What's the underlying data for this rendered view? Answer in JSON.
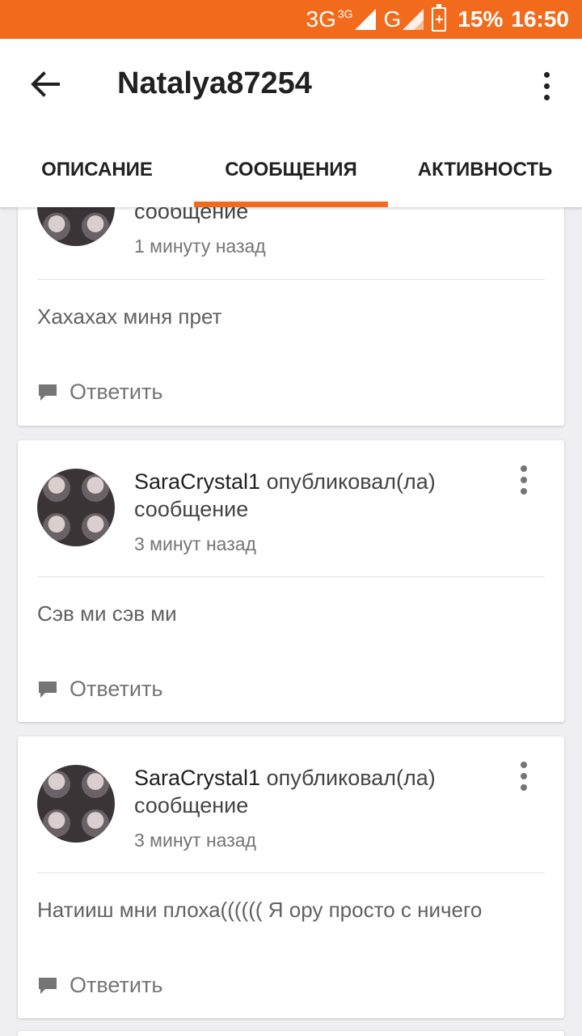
{
  "status_bar": {
    "network1": "3G",
    "network1_super": "3G",
    "network2": "G",
    "battery_percent": "15%",
    "time": "16:50",
    "color": "#f26a1b"
  },
  "header": {
    "title": "Natalya87254"
  },
  "tabs": [
    {
      "label": "ОПИСАНИЕ",
      "active": false
    },
    {
      "label": "СООБЩЕНИЯ",
      "active": true
    },
    {
      "label": "АКТИВНОСТЬ",
      "active": false
    }
  ],
  "posts": [
    {
      "author_line_partial": "сообщение",
      "time": "1 минуту назад",
      "message": "Хахахах миня прет",
      "reply_label": "Ответить"
    },
    {
      "author": "SaraCrystal1",
      "verb": "опубликовал(ла)",
      "object": "сообщение",
      "time": "3 минут назад",
      "message": "Сэв ми сэв ми",
      "reply_label": "Ответить"
    },
    {
      "author": "SaraCrystal1",
      "verb": "опубликовал(ла)",
      "object": "сообщение",
      "time": "3 минут назад",
      "message": "Натииш мни плоха(((((( Я ору просто с ничего",
      "reply_label": "Ответить"
    }
  ]
}
